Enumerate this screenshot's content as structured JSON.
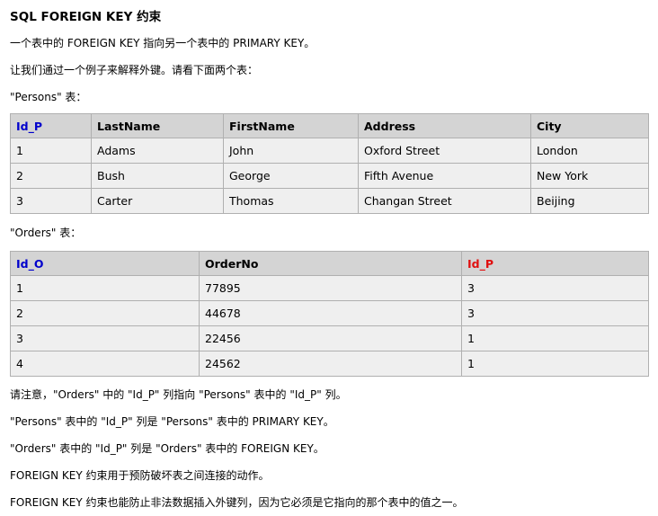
{
  "title": "SQL FOREIGN KEY 约束",
  "intro": "一个表中的 FOREIGN KEY 指向另一个表中的 PRIMARY KEY。",
  "example_intro": "让我们通过一个例子来解释外键。请看下面两个表：",
  "persons_caption": "\"Persons\" 表：",
  "persons_table": {
    "headers": [
      "Id_P",
      "LastName",
      "FirstName",
      "Address",
      "City"
    ],
    "rows": [
      [
        "1",
        "Adams",
        "John",
        "Oxford Street",
        "London"
      ],
      [
        "2",
        "Bush",
        "George",
        "Fifth Avenue",
        "New York"
      ],
      [
        "3",
        "Carter",
        "Thomas",
        "Changan Street",
        "Beijing"
      ]
    ]
  },
  "orders_caption": "\"Orders\" 表：",
  "orders_table": {
    "headers": [
      "Id_O",
      "OrderNo",
      "Id_P"
    ],
    "rows": [
      [
        "1",
        "77895",
        "3"
      ],
      [
        "2",
        "44678",
        "3"
      ],
      [
        "3",
        "22456",
        "1"
      ],
      [
        "4",
        "24562",
        "1"
      ]
    ]
  },
  "notes": [
    "请注意，\"Orders\" 中的 \"Id_P\" 列指向 \"Persons\" 表中的 \"Id_P\" 列。",
    "\"Persons\" 表中的 \"Id_P\" 列是 \"Persons\" 表中的 PRIMARY KEY。",
    "\"Orders\" 表中的 \"Id_P\" 列是 \"Orders\" 表中的 FOREIGN KEY。",
    "FOREIGN KEY 约束用于预防破坏表之间连接的动作。",
    "FOREIGN KEY 约束也能防止非法数据插入外键列，因为它必须是它指向的那个表中的值之一。"
  ],
  "colors": {
    "key_blue": "#0000cc",
    "key_red": "#e01010",
    "header_bg": "#d4d4d4",
    "cell_bg": "#efefef",
    "border": "#b0b0b0"
  }
}
